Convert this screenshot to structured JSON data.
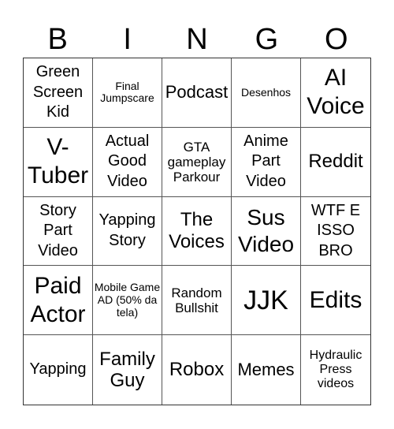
{
  "header": [
    "B",
    "I",
    "N",
    "G",
    "O"
  ],
  "cells": [
    "Green Screen Kid",
    "Final Jumpscare",
    "Podcast",
    "Desenhos",
    "AI Voice",
    "V-Tuber",
    "Actual Good Video",
    "GTA gameplay Parkour",
    "Anime Part Video",
    "Reddit",
    "Story Part Video",
    "Yapping Story",
    "The Voices",
    "Sus Video",
    "WTF E ISSO BRO",
    "Paid Actor",
    "Mobile Game AD (50% da tela)",
    "Random Bullshit",
    "JJK",
    "Edits",
    "Yapping",
    "Family Guy",
    "Robox",
    "Memes",
    "Hydraulic Press videos"
  ]
}
